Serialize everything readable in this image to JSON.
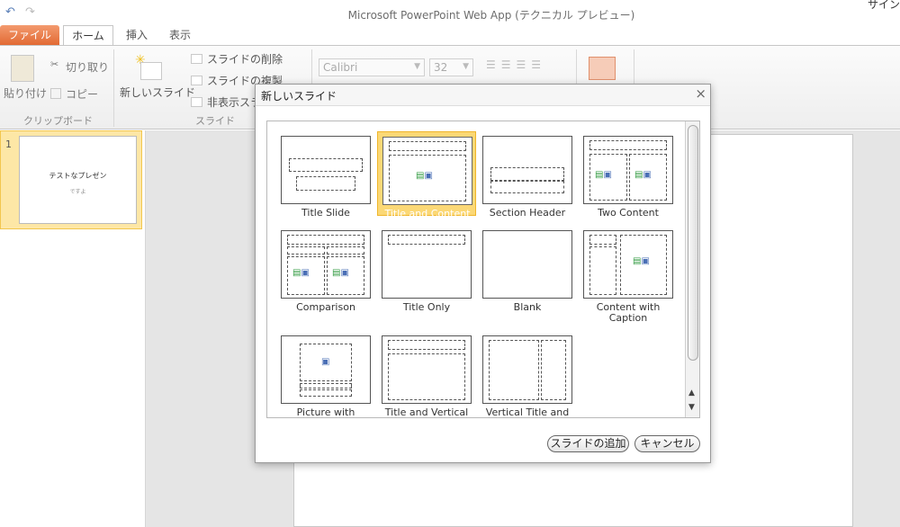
{
  "app": {
    "title": "Microsoft PowerPoint Web App (テクニカル プレビュー)",
    "sign_in": "サイン"
  },
  "quick_access": {
    "undo": "↶",
    "redo": "↷"
  },
  "tabs": [
    {
      "label": "ファイル"
    },
    {
      "label": "ホーム"
    },
    {
      "label": "挿入"
    },
    {
      "label": "表示"
    }
  ],
  "ribbon": {
    "clipboard": {
      "paste": "貼り付け",
      "cut": "切り取り",
      "copy": "コピー",
      "group": "クリップボード"
    },
    "slides": {
      "new_slide": "新しいスライド",
      "delete": "スライドの削除",
      "duplicate": "スライドの複製",
      "hide": "非表示スライド",
      "group": "スライド"
    },
    "font": {
      "name": "Calibri",
      "size": "32"
    }
  },
  "slide_panel": {
    "thumbnails": [
      {
        "number": "1",
        "title": "テストなプレゼン",
        "subtitle": "ですよ"
      }
    ]
  },
  "dialog": {
    "title": "新しいスライド",
    "close": "×",
    "layouts": [
      {
        "label": "Title Slide"
      },
      {
        "label": "Title and Content",
        "selected": true
      },
      {
        "label": "Section Header"
      },
      {
        "label": "Two Content"
      },
      {
        "label": "Comparison"
      },
      {
        "label": "Title Only"
      },
      {
        "label": "Blank"
      },
      {
        "label": "Content with Caption"
      },
      {
        "label": "Picture with"
      },
      {
        "label": "Title and Vertical"
      },
      {
        "label": "Vertical Title and"
      }
    ],
    "add_button": "スライドの追加",
    "cancel_button": "キャンセル"
  },
  "colors": {
    "file_tab": "#e26a34",
    "selection": "#fbd876",
    "thumb_highlight": "#fde7a6"
  }
}
